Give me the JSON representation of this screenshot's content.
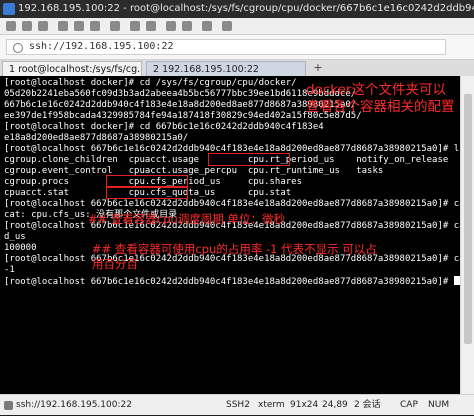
{
  "window": {
    "title": "192.168.195.100:22 - root@localhost:/sys/fs/cgroup/cpu/docker/667b6c1e16c0242d2ddb940c4f183e4e18a8..."
  },
  "address_bar": {
    "value": "ssh://192.168.195.100:22"
  },
  "tabs": [
    {
      "label": "1 root@localhost:/sys/fs/cg..."
    },
    {
      "label": "2 192.168.195.100:22"
    }
  ],
  "terminal": {
    "lines": [
      "[root@localhost docker]# cd /sys/fs/cgroup/cpu/docker/",
      "05d20b2241eba560fc09d3b3ad2abeea4b5bc56777bbc39ee1bd6118e9bdddce/",
      "667b6c1e16c0242d2ddb940c4f183e4e18a8d200ed8ae877d8687a38980215a0/",
      "ee397de1f958bcada4329985784fe94a187418f30829c94ed402a15f80c5e87d5/",
      "[root@localhost docker]# cd 667b6c1e16c0242d2ddb940c4f183e4",
      "e18a8d200ed8ae877d8687a38980215a0/",
      "[root@localhost 667b6c1e16c0242d2ddb940c4f183e4e18a8d200ed8ae877d8687a38980215a0]# ls",
      "cgroup.clone_children  cpuacct.usage         cpu.rt_period_us    notify_on_release",
      "cgroup.event_control   cpuacct.usage_percpu  cpu.rt_runtime_us   tasks",
      "cgroup.procs           cpu.cfs_period_us     cpu.shares",
      "cpuacct.stat           cpu.cfs_quota_us      cpu.stat",
      "[root@localhost 667b6c1e16c0242d2ddb940c4f183e4e18a8d200ed8ae877d8687a38980215a0]# cat cpu.cfs_us",
      "cat: cpu.cfs_us: 没有那个文件或目录",
      "[root@localhost 667b6c1e16c0242d2ddb940c4f183e4e18a8d200ed8ae877d8687a38980215a0]# cat cpu.cfs_perio",
      "d_us",
      "100000",
      "[root@localhost 667b6c1e16c0242d2ddb940c4f183e4e18a8d200ed8ae877d8687a38980215a0]# cat cpu.cfs_quota_us",
      "-1",
      "[root@localhost 667b6c1e16c0242d2ddb940c4f183e4e18a8d200ed8ae877d8687a38980215a0]# "
    ]
  },
  "annotations": {
    "docker_note_line1": "docker这个文件夹可以",
    "docker_note_line2": "查看各个容器相关的配置",
    "period_note": "## 查看容器cpu调度周期 单位：微秒",
    "quota_note_line1": "## 查看容器可使用cpu的占用率 -1 代表不显示 可以占",
    "quota_note_line2": "用百分百"
  },
  "status_bar": {
    "host": "ssh://192.168.195.100:22",
    "protocol": "SSH2",
    "term": "xterm",
    "size": "91x24",
    "position": "24,89",
    "sessions": "2 会话",
    "caps": "CAP",
    "num": "NUM"
  },
  "colors": {
    "annotation_red": "#ff2a2a",
    "terminal_bg": "#000000",
    "terminal_fg": "#ffffff"
  }
}
